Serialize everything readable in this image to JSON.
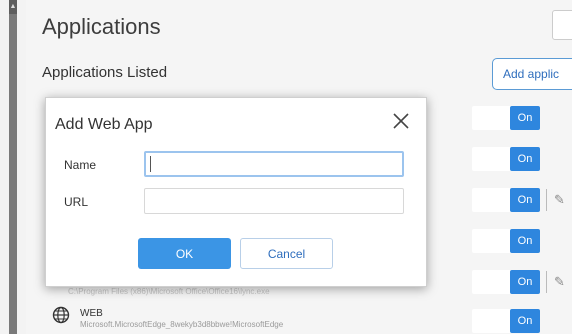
{
  "page": {
    "title": "Applications",
    "section_title": "Applications Listed",
    "add_button_label": "Add applic"
  },
  "toggles": [
    {
      "label": "On"
    },
    {
      "label": "On"
    },
    {
      "label": "On"
    },
    {
      "label": "On"
    },
    {
      "label": "On"
    },
    {
      "label": "On"
    }
  ],
  "list": {
    "partial_path": "C:\\Program Files (x86)\\Microsoft Office\\Office16\\lync.exe",
    "web_item": {
      "type_label": "WEB",
      "path": "Microsoft.MicrosoftEdge_8wekyb3d8bbwe!MicrosoftEdge",
      "icon": "globe-icon"
    }
  },
  "dialog": {
    "title": "Add Web App",
    "name_label": "Name",
    "name_value": "",
    "url_label": "URL",
    "url_value": "",
    "ok_label": "OK",
    "cancel_label": "Cancel",
    "close_icon": "close-icon"
  },
  "colors": {
    "accent": "#2e86de",
    "ok_button": "#3b95e5",
    "background": "#f3f3f3"
  }
}
